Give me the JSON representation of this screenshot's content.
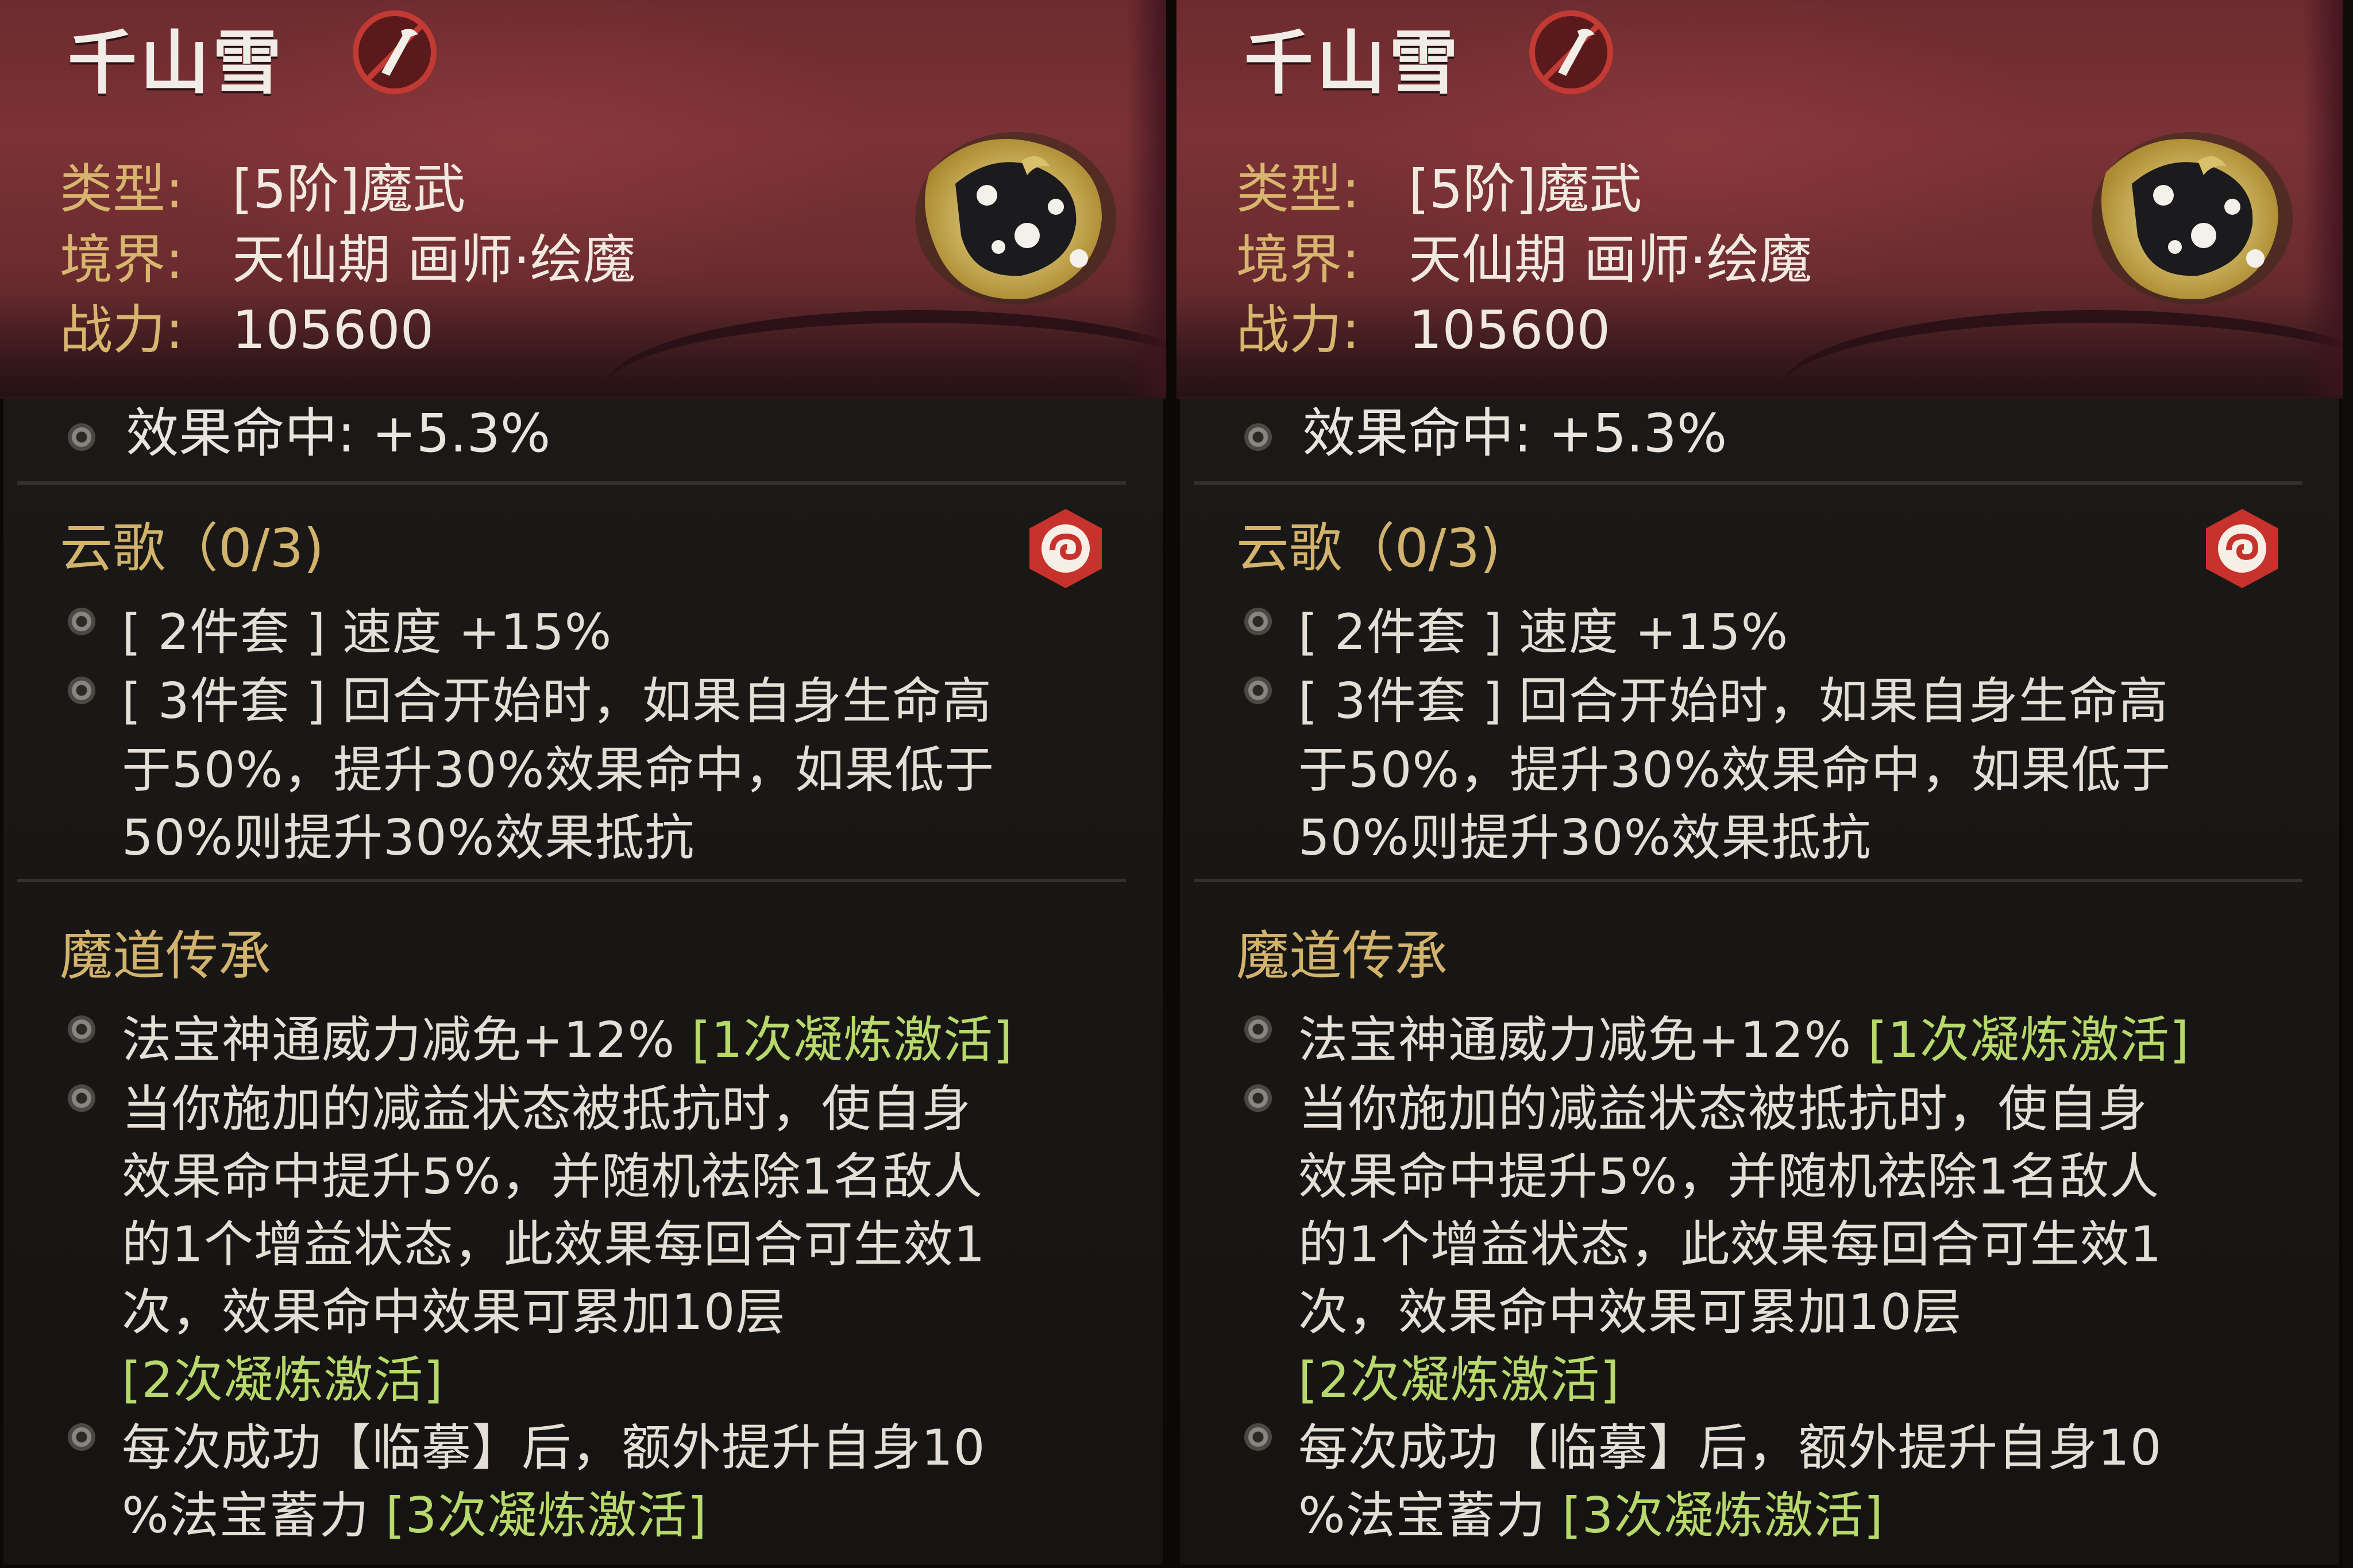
{
  "colors": {
    "accent_gold": "#d2b36d",
    "accent_green": "#b7d96b",
    "header_red": "#7b3236",
    "text": "#e3ded6"
  },
  "icons": {
    "title_badge": "forbidden-quill-icon",
    "artifact": "ornate-artifact-icon",
    "set": "cloud-set-badge-icon",
    "bullet": "rune-bullet-icon"
  },
  "panels": [
    {
      "title": "千山雪",
      "type_label": "类型:",
      "type_value": "[5阶]魔武",
      "realm_label": "境界:",
      "realm_value": "天仙期 画师·绘魔",
      "power_label": "战力:",
      "power_value": "105600",
      "stat": "效果命中: +5.3%",
      "set_title": "云歌（0/3)",
      "set_line1": "[ 2件套 ] 速度 +15%",
      "set_line2": "[ 3件套 ] 回合开始时，如果自身生命高",
      "set_line3": "于50%，提升30%效果命中，如果低于",
      "set_line4": "50%则提升30%效果抵抗",
      "legacy_title": "魔道传承",
      "leg1_text": "法宝神通威力减免+12% ",
      "leg1_tag": "[1次凝炼激活]",
      "leg2_line1": "当你施加的减益状态被抵抗时，使自身",
      "leg2_line2": "效果命中提升5%，并随机祛除1名敌人",
      "leg2_line3": "的1个增益状态，此效果每回合可生效1",
      "leg2_line4": "次，效果命中效果可累加10层",
      "leg2_tag": "[2次凝炼激活]",
      "leg3_line1": "每次成功【临摹】后，额外提升自身10",
      "leg3_line2": "%法宝蓄力 ",
      "leg3_tag": "[3次凝炼激活]"
    },
    {
      "title": "千山雪",
      "type_label": "类型:",
      "type_value": "[5阶]魔武",
      "realm_label": "境界:",
      "realm_value": "天仙期 画师·绘魔",
      "power_label": "战力:",
      "power_value": "105600",
      "stat": "效果命中: +5.3%",
      "set_title": "云歌（0/3)",
      "set_line1": "[ 2件套 ] 速度 +15%",
      "set_line2": "[ 3件套 ] 回合开始时，如果自身生命高",
      "set_line3": "于50%，提升30%效果命中，如果低于",
      "set_line4": "50%则提升30%效果抵抗",
      "legacy_title": "魔道传承",
      "leg1_text": "法宝神通威力减免+12% ",
      "leg1_tag": "[1次凝炼激活]",
      "leg2_line1": "当你施加的减益状态被抵抗时，使自身",
      "leg2_line2": "效果命中提升5%，并随机祛除1名敌人",
      "leg2_line3": "的1个增益状态，此效果每回合可生效1",
      "leg2_line4": "次，效果命中效果可累加10层",
      "leg2_tag": "[2次凝炼激活]",
      "leg3_line1": "每次成功【临摹】后，额外提升自身10",
      "leg3_line2": "%法宝蓄力 ",
      "leg3_tag": "[3次凝炼激活]"
    }
  ]
}
